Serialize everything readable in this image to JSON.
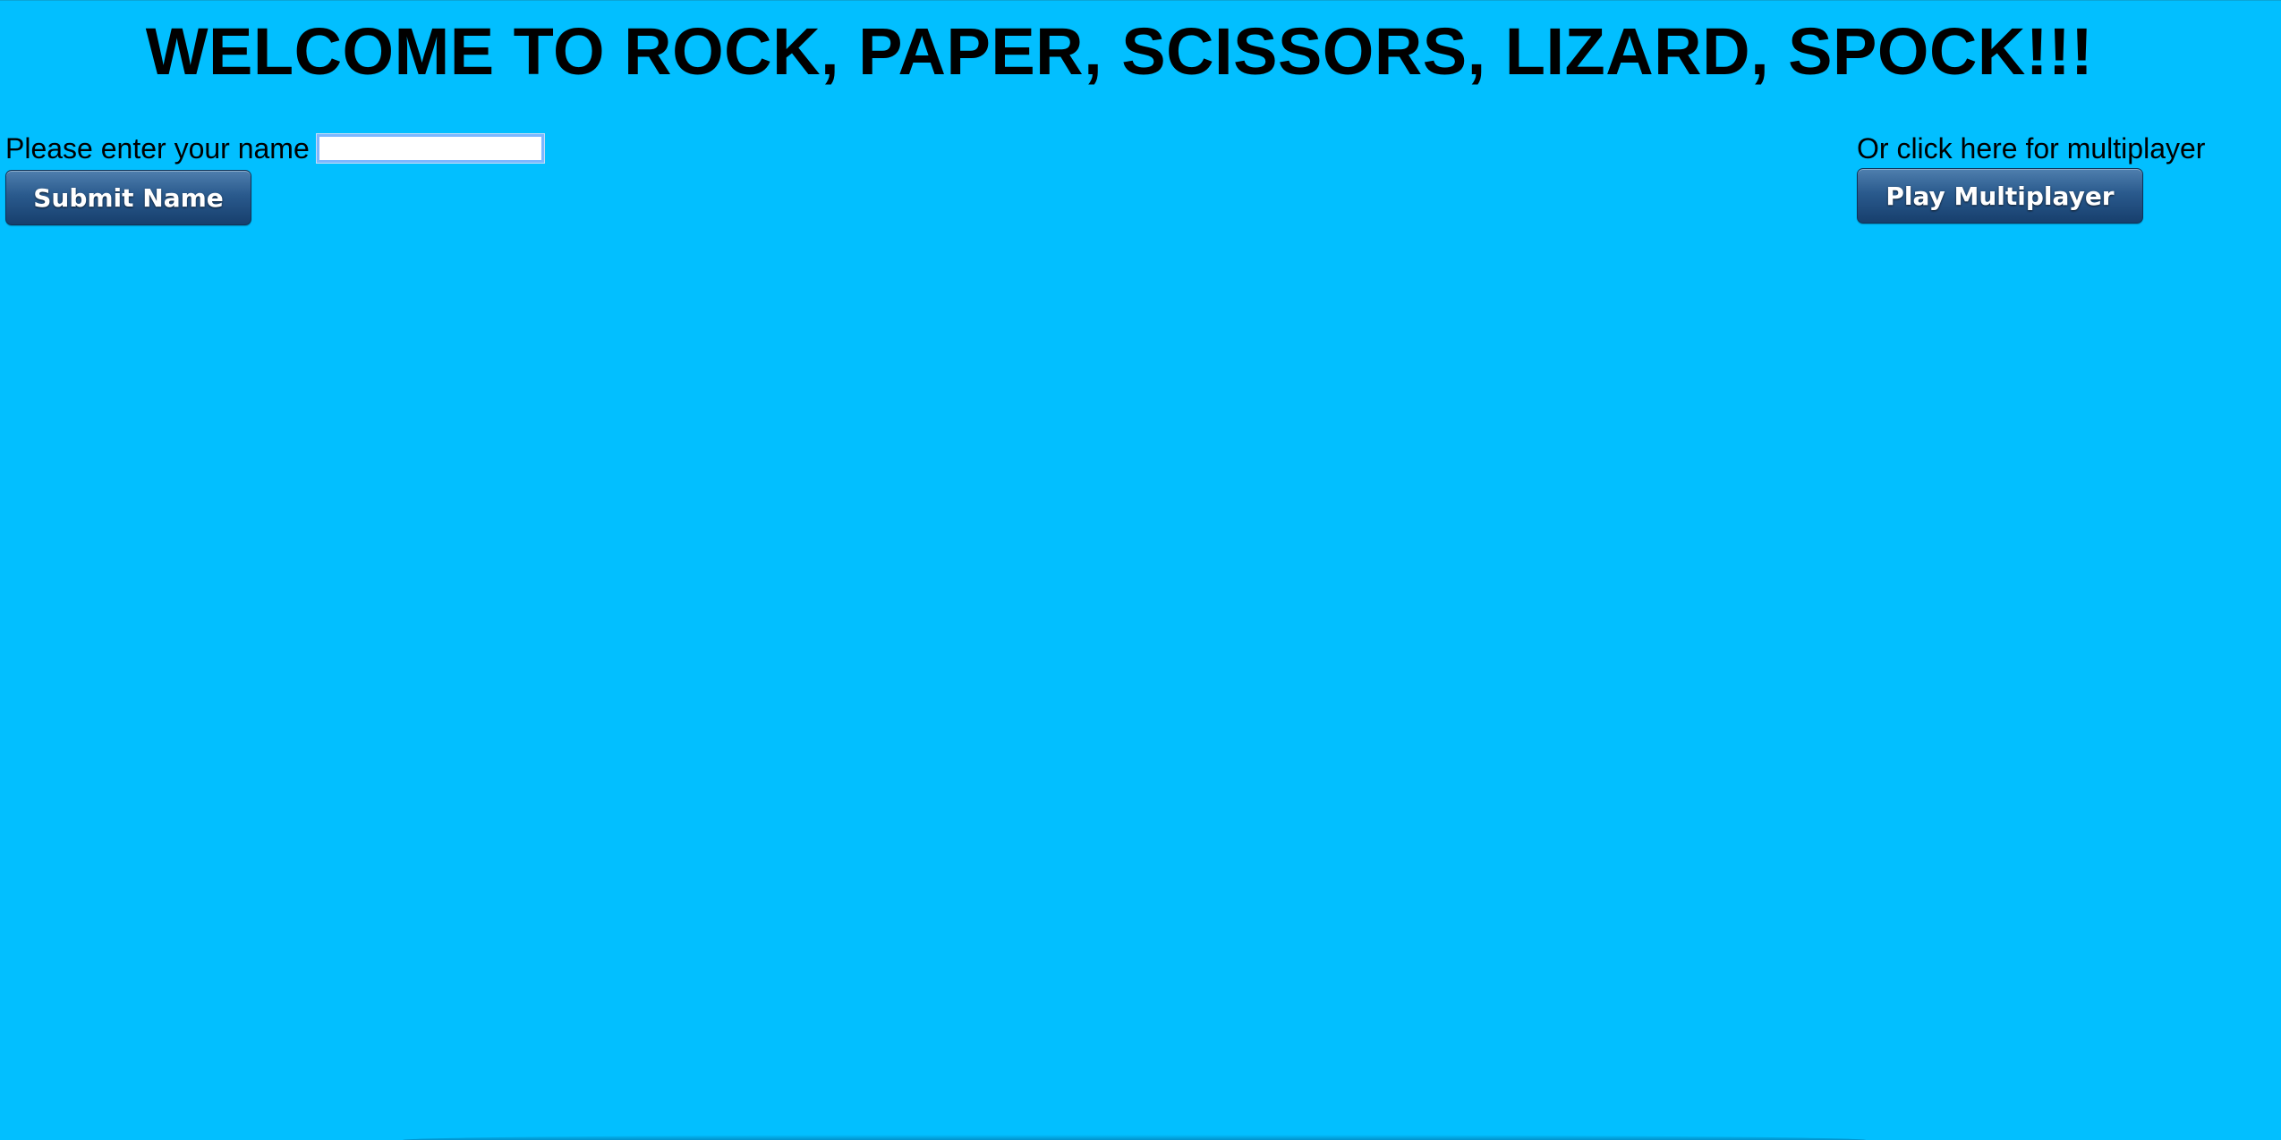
{
  "header": {
    "title": "WELCOME TO ROCK, PAPER, SCISSORS, LIZARD, SPOCK!!!"
  },
  "name_form": {
    "label": "Please enter your name",
    "input_value": "",
    "submit_label": "Submit Name"
  },
  "multiplayer": {
    "label": "Or click here for multiplayer",
    "button_label": "Play Multiplayer"
  },
  "colors": {
    "background": "#02bfff",
    "button_top": "#4f7fae",
    "button_bottom": "#173f6d",
    "input_border": "#7db7ff"
  }
}
